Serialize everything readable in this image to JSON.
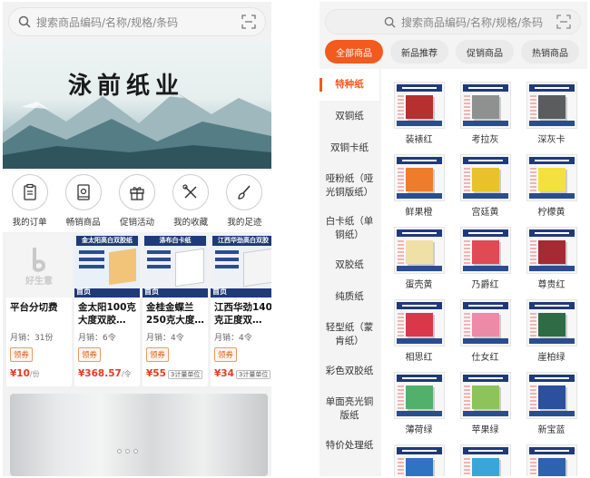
{
  "left": {
    "search": {
      "placeholder": "搜索商品编码/名称/规格/条码"
    },
    "banner": {
      "title": "泳前纸业"
    },
    "quick_links": [
      {
        "label": "我的订单",
        "icon": "clipboard-icon"
      },
      {
        "label": "畅销商品",
        "icon": "book-icon"
      },
      {
        "label": "促销活动",
        "icon": "gift-icon"
      },
      {
        "label": "我的收藏",
        "icon": "tools-icon"
      },
      {
        "label": "我的足迹",
        "icon": "brush-icon"
      }
    ],
    "products": [
      {
        "title": "平台分切费",
        "sales": "月销：31份",
        "coupon": "领券",
        "price": "¥10",
        "unit": "/份",
        "logo_text": "好生意"
      },
      {
        "title": "金太阳100克大度双胶…",
        "sales": "月销：6令",
        "coupon": "领券",
        "price": "¥368.57",
        "unit": "/令",
        "image_caption": "金太阳高白双胶纸",
        "badge": "首页"
      },
      {
        "title": "金桂金蝶兰250克大度…",
        "sales": "月销：4令",
        "coupon": "领券",
        "price": "¥55",
        "unit_tag": "3计量单位",
        "image_caption": "涤布白卡纸",
        "badge": "首页"
      },
      {
        "title": "江西华劲140克正度双…",
        "sales": "月销：4令",
        "coupon": "领券",
        "price": "¥34",
        "unit_tag": "3计量单位",
        "image_caption": "江西华劲高白双胶",
        "badge": "首页"
      }
    ]
  },
  "right": {
    "search": {
      "placeholder": "搜索商品编码/名称/规格/条码"
    },
    "tabs": [
      "全部商品",
      "新品推荐",
      "促销商品",
      "热销商品"
    ],
    "categories": [
      "特种纸",
      "双铜纸",
      "双铜卡纸",
      "哑粉纸（哑光铜版纸）",
      "白卡纸（单铜纸）",
      "双胶纸",
      "纯质纸",
      "轻型纸（蒙肯纸）",
      "彩色双胶纸",
      "单面亮光铜版纸",
      "特价处理纸"
    ],
    "products": [
      {
        "name": "装裱红",
        "color": "#b5302e"
      },
      {
        "name": "考拉灰",
        "color": "#8f9191"
      },
      {
        "name": "深灰卡",
        "color": "#5a5c5d"
      },
      {
        "name": "鲜果橙",
        "color": "#ef7c2a"
      },
      {
        "name": "宫廷黄",
        "color": "#e8c22a"
      },
      {
        "name": "柠檬黄",
        "color": "#f3e13f"
      },
      {
        "name": "蛋壳黄",
        "color": "#efe0a5"
      },
      {
        "name": "乃爵红",
        "color": "#e04a55"
      },
      {
        "name": "尊贵红",
        "color": "#a52a33"
      },
      {
        "name": "相思红",
        "color": "#d8384a"
      },
      {
        "name": "仕女红",
        "color": "#ec8aa8"
      },
      {
        "name": "崖柏绿",
        "color": "#2f6b45"
      },
      {
        "name": "薄荷绿",
        "color": "#52b06a"
      },
      {
        "name": "苹果绿",
        "color": "#8cc35a"
      },
      {
        "name": "新宝蓝",
        "color": "#2c4f9e"
      },
      {
        "name": "",
        "color": "#2f73c2"
      },
      {
        "name": "",
        "color": "#3aa6d8"
      },
      {
        "name": "",
        "color": "#2d62b0"
      }
    ]
  },
  "colors": {
    "accent": "#f25a1e",
    "price": "#e53b1c"
  }
}
